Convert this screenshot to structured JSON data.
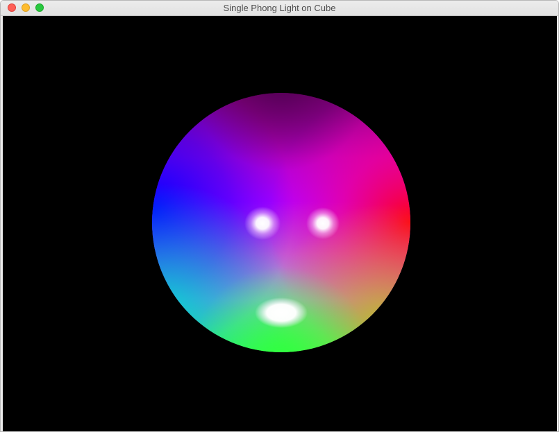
{
  "window": {
    "title": "Single Phong Light on Cube"
  },
  "controls": {
    "close_icon": "close-icon",
    "minimize_icon": "minimize-icon",
    "maximize_icon": "maximize-icon"
  },
  "scene": {
    "background": "#000000",
    "object": "sphere",
    "colors": {
      "top": "#800080",
      "left": "#0000ff",
      "right": "#ff0000",
      "center": "#c800ff",
      "bottom": "#33ff33",
      "highlight": "#ffffff"
    }
  }
}
